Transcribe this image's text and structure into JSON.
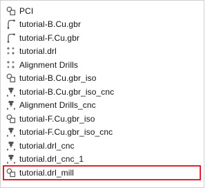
{
  "colors": {
    "selection_border": "#e0202e",
    "icon": "#555555",
    "text": "#111111"
  },
  "objects": [
    {
      "label": "PCI",
      "icon": "geometry-icon"
    },
    {
      "label": "tutorial-B.Cu.gbr",
      "icon": "gerber-icon"
    },
    {
      "label": "tutorial-F.Cu.gbr",
      "icon": "gerber-icon"
    },
    {
      "label": "tutorial.drl",
      "icon": "drill-icon"
    },
    {
      "label": "Alignment Drills",
      "icon": "drill-icon"
    },
    {
      "label": "tutorial-B.Cu.gbr_iso",
      "icon": "geometry-icon"
    },
    {
      "label": "tutorial-B.Cu.gbr_iso_cnc",
      "icon": "cnc-icon"
    },
    {
      "label": "Alignment Drills_cnc",
      "icon": "cnc-icon"
    },
    {
      "label": "tutorial-F.Cu.gbr_iso",
      "icon": "geometry-icon"
    },
    {
      "label": "tutorial-F.Cu.gbr_iso_cnc",
      "icon": "cnc-icon"
    },
    {
      "label": "tutorial.drl_cnc",
      "icon": "cnc-icon"
    },
    {
      "label": "tutorial.drl_cnc_1",
      "icon": "cnc-icon"
    },
    {
      "label": "tutorial.drl_mill",
      "icon": "geometry-icon",
      "selected": true
    }
  ]
}
